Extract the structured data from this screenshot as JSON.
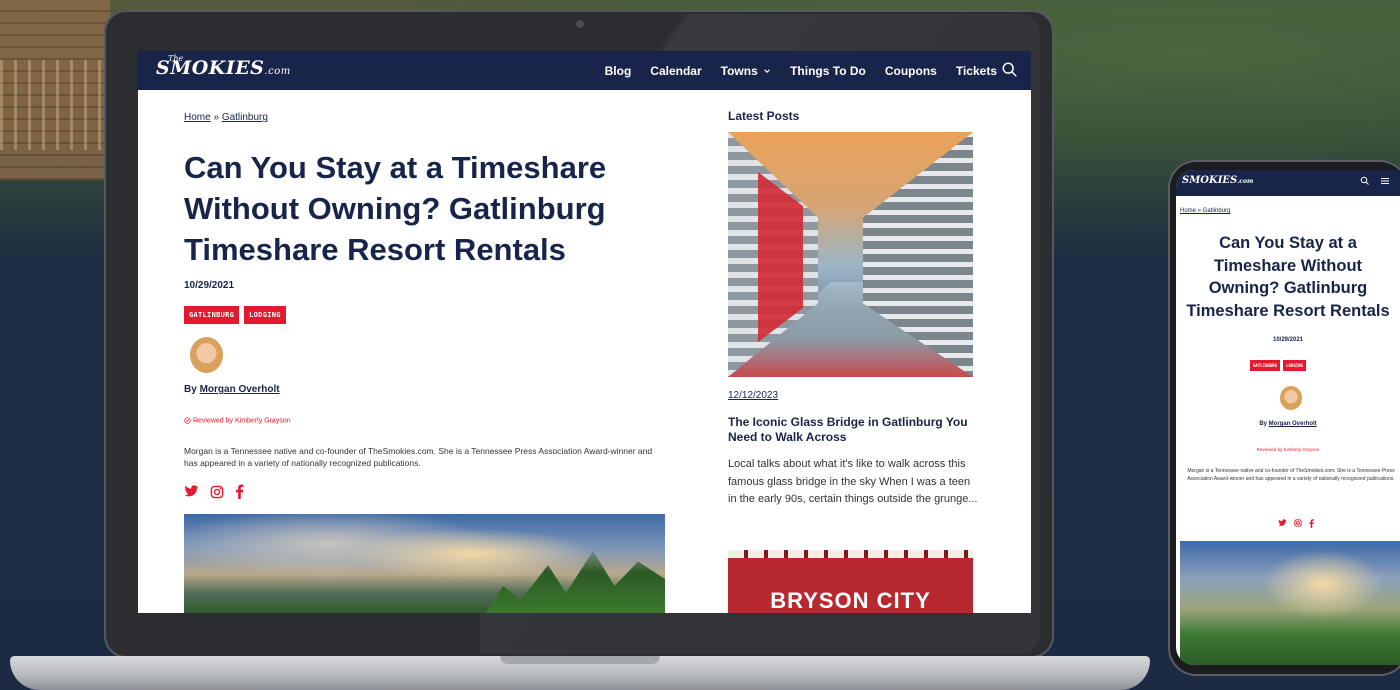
{
  "site": {
    "logo_the": "The",
    "logo_main": "SMOKIES",
    "logo_suffix": ".com",
    "nav": {
      "blog": "Blog",
      "calendar": "Calendar",
      "towns": "Towns",
      "things_to_do": "Things To Do",
      "coupons": "Coupons",
      "tickets": "Tickets"
    },
    "icons": {
      "search": "search-icon",
      "towns_dropdown": "chevron-down-icon",
      "menu": "hamburger-menu-icon"
    },
    "colors": {
      "nav_bg": "#18244a",
      "accent_red": "#e3192f",
      "text_navy": "#18244a"
    }
  },
  "article": {
    "breadcrumb": {
      "home": "Home",
      "separator": "»",
      "current": "Gatlinburg"
    },
    "title": "Can You Stay at a Timeshare Without Owning? Gatlinburg Timeshare Resort Rentals",
    "date": "10/29/2021",
    "tags": [
      "GATLINBURG",
      "LODGING"
    ],
    "byline_prefix": "By ",
    "author": "Morgan Overholt",
    "reviewed": "Reviewed by Kimberly Grayson",
    "bio": "Morgan is a Tennessee native and co-founder of TheSmokies.com. She is a Tennessee Press Association Award-winner and has appeared in a variety of nationally recognized publications.",
    "social": [
      "twitter-icon",
      "instagram-icon",
      "facebook-icon"
    ]
  },
  "sidebar": {
    "heading": "Latest Posts",
    "posts": [
      {
        "date": "12/12/2023",
        "title": "The Iconic Glass Bridge in Gatlinburg You Need to Walk Across",
        "excerpt": "Local talks about what it's like to walk across this famous glass bridge in the sky When I was a teen in the early 90s, certain things outside the grunge..."
      },
      {
        "image_text": "BRYSON CITY"
      }
    ]
  },
  "mobile": {
    "breadcrumb": "Home » Gatlinburg",
    "title_lines": [
      "Can You Stay at a",
      "Timeshare Without",
      "Owning? Gatlinburg",
      "Timeshare Resort Rentals"
    ],
    "bio": "Morgan is a Tennessee native and co-founder of TheSmokies.com. She is a Tennessee Press Association Award-winner and has appeared in a variety of nationally recognized publications."
  }
}
